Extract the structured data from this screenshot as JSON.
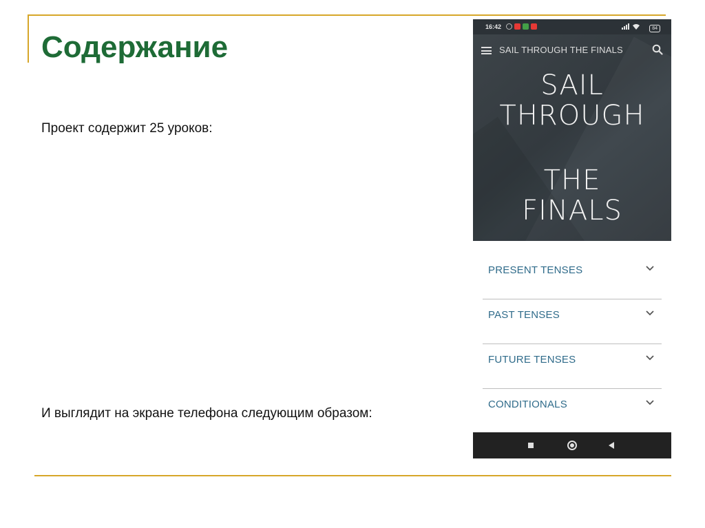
{
  "slide": {
    "title": "Содержание",
    "text_lessons": "Проект содержит 25 уроков:",
    "text_phone": "И выглядит на экране телефона следующим образом:"
  },
  "phone": {
    "status": {
      "time": "16:42",
      "battery": "84"
    },
    "appbar": {
      "title": "SAIL THROUGH THE FINALS"
    },
    "hero": {
      "line1": "SAIL",
      "line2": "THROUGH",
      "line3": "THE",
      "line4": "FINALS"
    },
    "sections": [
      {
        "label": "PRESENT TENSES"
      },
      {
        "label": "PAST TENSES"
      },
      {
        "label": "FUTURE TENSES"
      },
      {
        "label": "CONDITIONALS"
      }
    ]
  },
  "colors": {
    "title_green": "#1e6b36",
    "accent_gold": "#d6a628",
    "section_blue": "#2f6b8a"
  }
}
